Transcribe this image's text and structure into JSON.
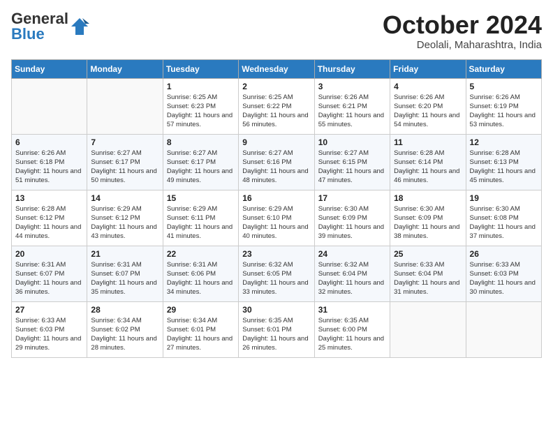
{
  "logo": {
    "general": "General",
    "blue": "Blue"
  },
  "title": "October 2024",
  "location": "Deolali, Maharashtra, India",
  "days_header": [
    "Sunday",
    "Monday",
    "Tuesday",
    "Wednesday",
    "Thursday",
    "Friday",
    "Saturday"
  ],
  "weeks": [
    [
      {
        "day": "",
        "info": ""
      },
      {
        "day": "",
        "info": ""
      },
      {
        "day": "1",
        "info": "Sunrise: 6:25 AM\nSunset: 6:23 PM\nDaylight: 11 hours and 57 minutes."
      },
      {
        "day": "2",
        "info": "Sunrise: 6:25 AM\nSunset: 6:22 PM\nDaylight: 11 hours and 56 minutes."
      },
      {
        "day": "3",
        "info": "Sunrise: 6:26 AM\nSunset: 6:21 PM\nDaylight: 11 hours and 55 minutes."
      },
      {
        "day": "4",
        "info": "Sunrise: 6:26 AM\nSunset: 6:20 PM\nDaylight: 11 hours and 54 minutes."
      },
      {
        "day": "5",
        "info": "Sunrise: 6:26 AM\nSunset: 6:19 PM\nDaylight: 11 hours and 53 minutes."
      }
    ],
    [
      {
        "day": "6",
        "info": "Sunrise: 6:26 AM\nSunset: 6:18 PM\nDaylight: 11 hours and 51 minutes."
      },
      {
        "day": "7",
        "info": "Sunrise: 6:27 AM\nSunset: 6:17 PM\nDaylight: 11 hours and 50 minutes."
      },
      {
        "day": "8",
        "info": "Sunrise: 6:27 AM\nSunset: 6:17 PM\nDaylight: 11 hours and 49 minutes."
      },
      {
        "day": "9",
        "info": "Sunrise: 6:27 AM\nSunset: 6:16 PM\nDaylight: 11 hours and 48 minutes."
      },
      {
        "day": "10",
        "info": "Sunrise: 6:27 AM\nSunset: 6:15 PM\nDaylight: 11 hours and 47 minutes."
      },
      {
        "day": "11",
        "info": "Sunrise: 6:28 AM\nSunset: 6:14 PM\nDaylight: 11 hours and 46 minutes."
      },
      {
        "day": "12",
        "info": "Sunrise: 6:28 AM\nSunset: 6:13 PM\nDaylight: 11 hours and 45 minutes."
      }
    ],
    [
      {
        "day": "13",
        "info": "Sunrise: 6:28 AM\nSunset: 6:12 PM\nDaylight: 11 hours and 44 minutes."
      },
      {
        "day": "14",
        "info": "Sunrise: 6:29 AM\nSunset: 6:12 PM\nDaylight: 11 hours and 43 minutes."
      },
      {
        "day": "15",
        "info": "Sunrise: 6:29 AM\nSunset: 6:11 PM\nDaylight: 11 hours and 41 minutes."
      },
      {
        "day": "16",
        "info": "Sunrise: 6:29 AM\nSunset: 6:10 PM\nDaylight: 11 hours and 40 minutes."
      },
      {
        "day": "17",
        "info": "Sunrise: 6:30 AM\nSunset: 6:09 PM\nDaylight: 11 hours and 39 minutes."
      },
      {
        "day": "18",
        "info": "Sunrise: 6:30 AM\nSunset: 6:09 PM\nDaylight: 11 hours and 38 minutes."
      },
      {
        "day": "19",
        "info": "Sunrise: 6:30 AM\nSunset: 6:08 PM\nDaylight: 11 hours and 37 minutes."
      }
    ],
    [
      {
        "day": "20",
        "info": "Sunrise: 6:31 AM\nSunset: 6:07 PM\nDaylight: 11 hours and 36 minutes."
      },
      {
        "day": "21",
        "info": "Sunrise: 6:31 AM\nSunset: 6:07 PM\nDaylight: 11 hours and 35 minutes."
      },
      {
        "day": "22",
        "info": "Sunrise: 6:31 AM\nSunset: 6:06 PM\nDaylight: 11 hours and 34 minutes."
      },
      {
        "day": "23",
        "info": "Sunrise: 6:32 AM\nSunset: 6:05 PM\nDaylight: 11 hours and 33 minutes."
      },
      {
        "day": "24",
        "info": "Sunrise: 6:32 AM\nSunset: 6:04 PM\nDaylight: 11 hours and 32 minutes."
      },
      {
        "day": "25",
        "info": "Sunrise: 6:33 AM\nSunset: 6:04 PM\nDaylight: 11 hours and 31 minutes."
      },
      {
        "day": "26",
        "info": "Sunrise: 6:33 AM\nSunset: 6:03 PM\nDaylight: 11 hours and 30 minutes."
      }
    ],
    [
      {
        "day": "27",
        "info": "Sunrise: 6:33 AM\nSunset: 6:03 PM\nDaylight: 11 hours and 29 minutes."
      },
      {
        "day": "28",
        "info": "Sunrise: 6:34 AM\nSunset: 6:02 PM\nDaylight: 11 hours and 28 minutes."
      },
      {
        "day": "29",
        "info": "Sunrise: 6:34 AM\nSunset: 6:01 PM\nDaylight: 11 hours and 27 minutes."
      },
      {
        "day": "30",
        "info": "Sunrise: 6:35 AM\nSunset: 6:01 PM\nDaylight: 11 hours and 26 minutes."
      },
      {
        "day": "31",
        "info": "Sunrise: 6:35 AM\nSunset: 6:00 PM\nDaylight: 11 hours and 25 minutes."
      },
      {
        "day": "",
        "info": ""
      },
      {
        "day": "",
        "info": ""
      }
    ]
  ]
}
